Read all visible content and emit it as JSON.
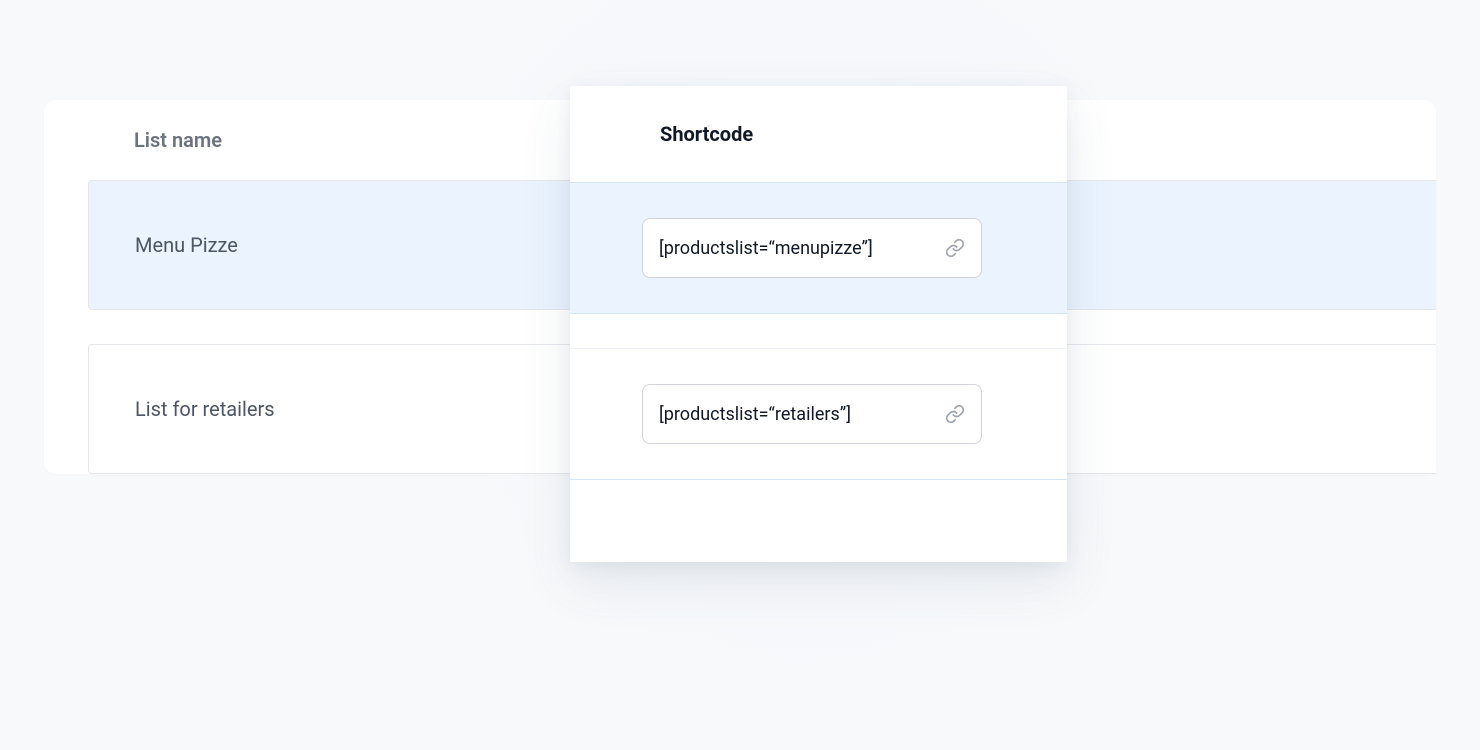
{
  "header": {
    "listname_label": "List name",
    "shortcode_label": "Shortcode"
  },
  "rows": [
    {
      "name": "Menu Pizze",
      "shortcode": "[productslist=“menupizze”]",
      "highlighted": true
    },
    {
      "name": "List for retailers",
      "shortcode": "[productslist=“retailers”]",
      "highlighted": false
    }
  ]
}
